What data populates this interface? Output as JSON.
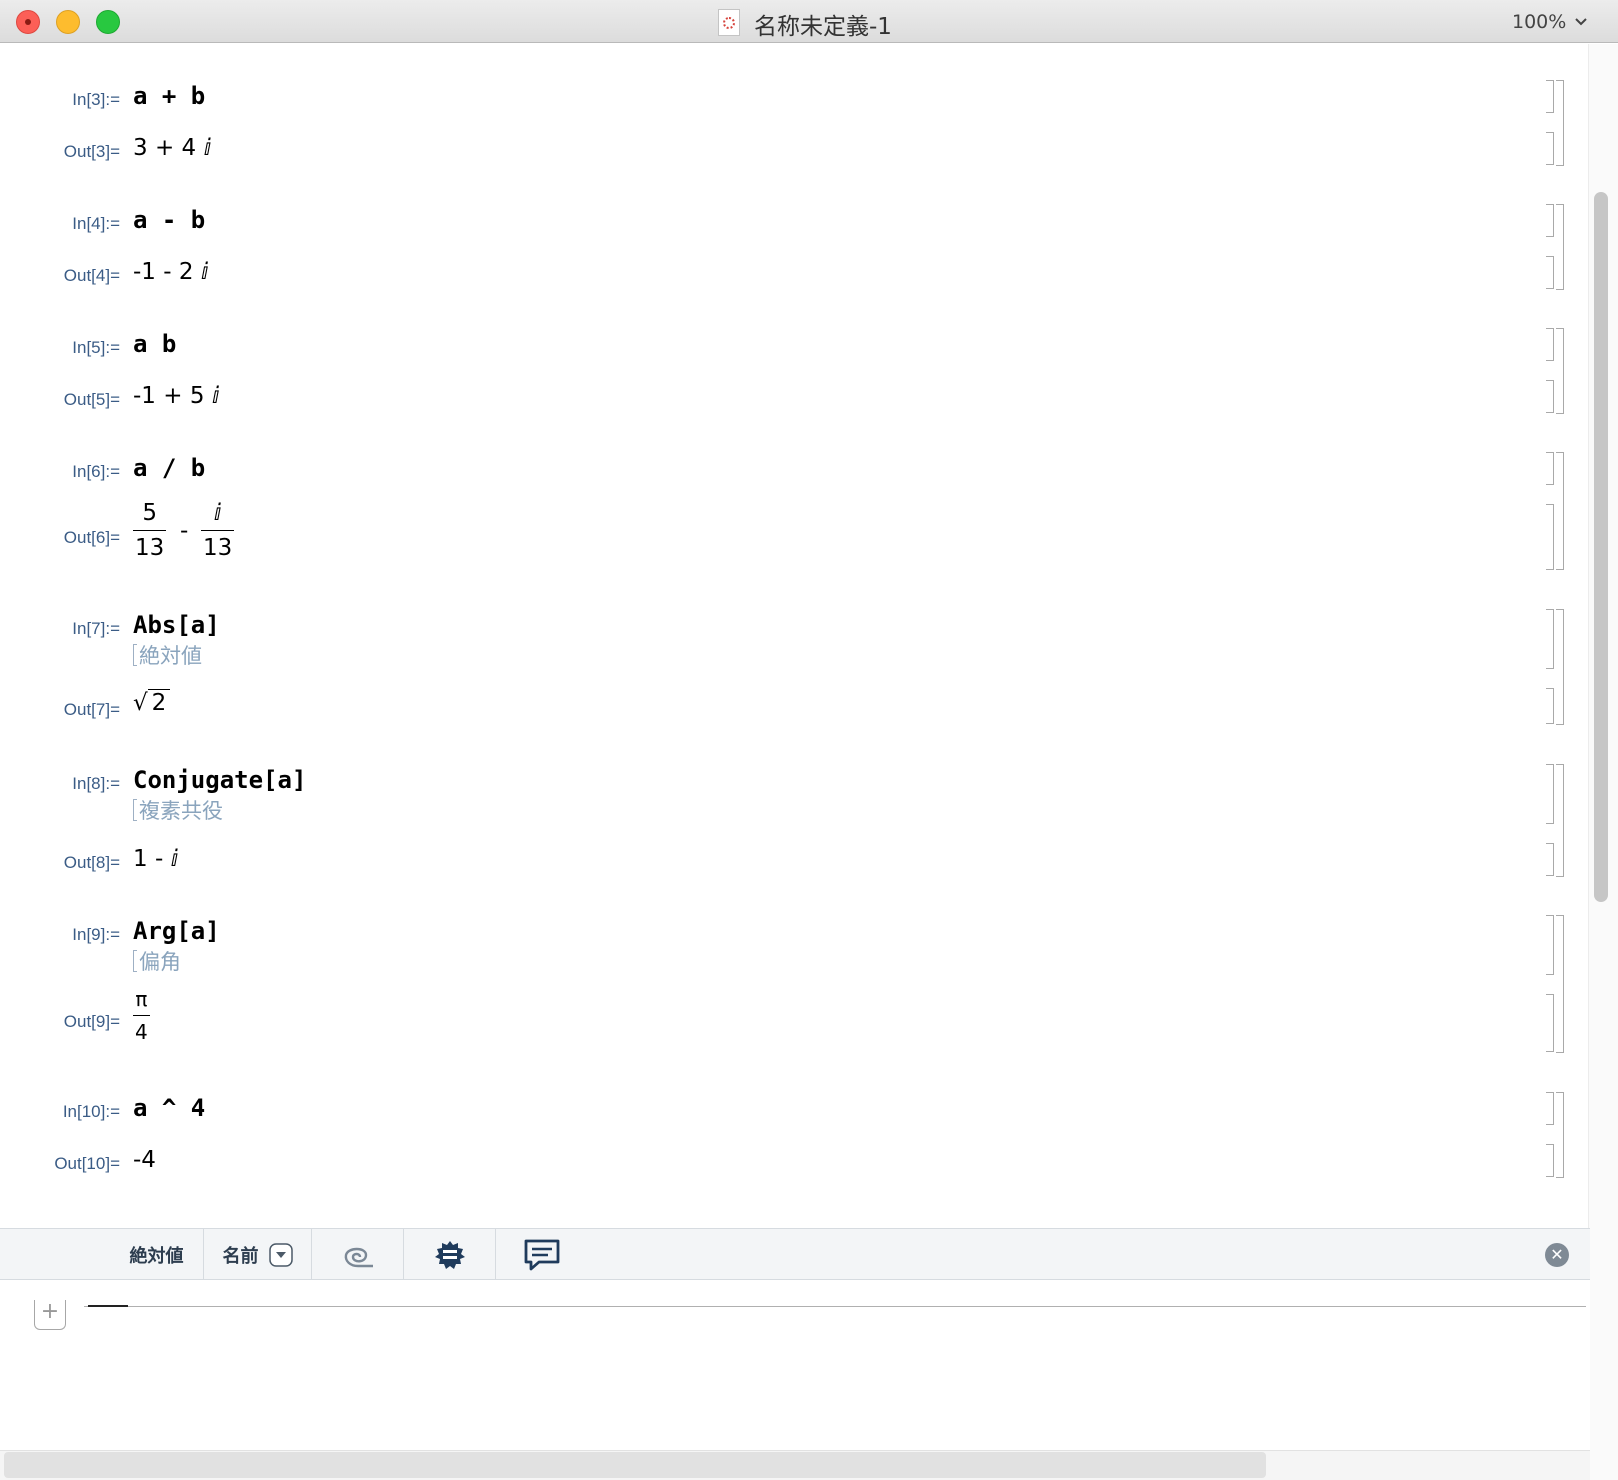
{
  "window": {
    "title": "名称未定義-1",
    "zoom": "100%"
  },
  "cells": {
    "c3": {
      "in_label": "In[3]:=",
      "input": "a + b",
      "out_label": "Out[3]=",
      "output": "3 + 4 ⅈ"
    },
    "c4": {
      "in_label": "In[4]:=",
      "input": "a - b",
      "out_label": "Out[4]=",
      "output": "-1 - 2 ⅈ"
    },
    "c5": {
      "in_label": "In[5]:=",
      "input": "a b",
      "out_label": "Out[5]=",
      "output": "-1 + 5 ⅈ"
    },
    "c6": {
      "in_label": "In[6]:=",
      "input": "a / b",
      "out_label": "Out[6]=",
      "frac1_num": "5",
      "frac1_den": "13",
      "minus": "-",
      "frac2_num": "ⅈ",
      "frac2_den": "13"
    },
    "c7": {
      "in_label": "In[7]:=",
      "input": "Abs[a]",
      "hint": "絶対値",
      "out_label": "Out[7]=",
      "sqrt_sign": "√",
      "radicand": "2"
    },
    "c8": {
      "in_label": "In[8]:=",
      "input": "Conjugate[a]",
      "hint": "複素共役",
      "out_label": "Out[8]=",
      "output": "1 - ⅈ"
    },
    "c9": {
      "in_label": "In[9]:=",
      "input": "Arg[a]",
      "hint": "偏角",
      "out_label": "Out[9]=",
      "frac_num": "π",
      "frac_den": "4"
    },
    "c10": {
      "in_label": "In[10]:=",
      "input": "a ^ 4",
      "out_label": "Out[10]=",
      "output": "-4"
    }
  },
  "toolbar": {
    "function_name": "絶対値",
    "name_dropdown": "名前",
    "icons": [
      "spiral-icon",
      "gear-icon",
      "comment-icon"
    ]
  },
  "colors": {
    "label": "#3b5c86",
    "hint": "#8aa4bd",
    "bracket": "#a9a9a9"
  }
}
